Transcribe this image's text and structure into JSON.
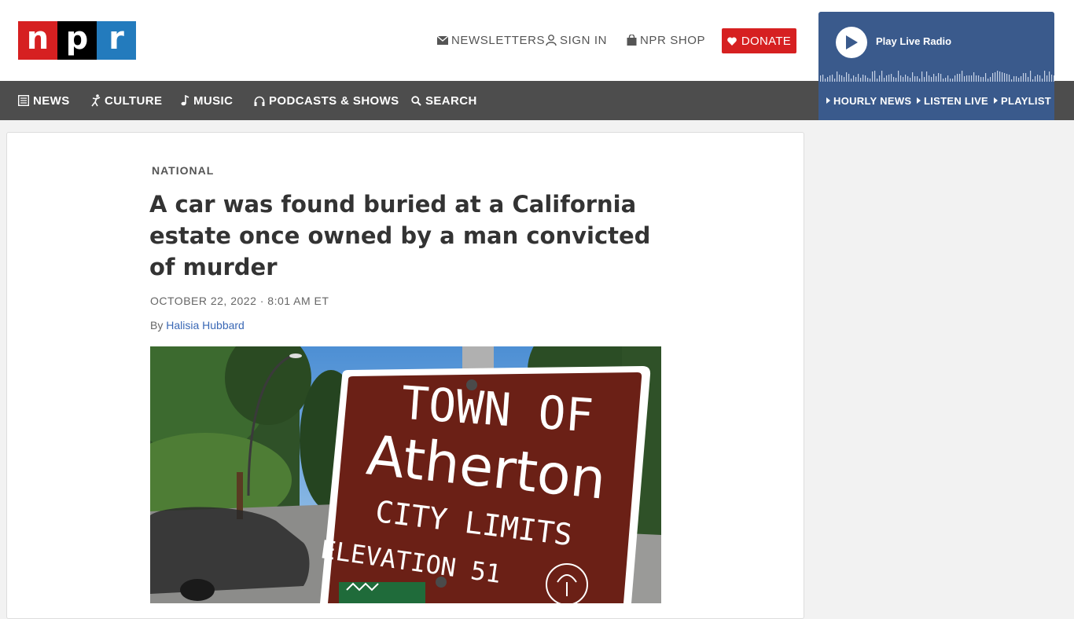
{
  "logo": {
    "letters": [
      "n",
      "p",
      "r"
    ]
  },
  "utility": {
    "newsletters": "NEWSLETTERS",
    "sign_in": "SIGN IN",
    "npr_shop": "NPR SHOP",
    "donate": "DONATE"
  },
  "nav": {
    "news": "NEWS",
    "culture": "CULTURE",
    "music": "MUSIC",
    "podcasts": "PODCASTS & SHOWS",
    "search": "SEARCH"
  },
  "radio": {
    "play_label": "Play Live Radio",
    "hourly_news": "HOURLY NEWS",
    "listen_live": "LISTEN LIVE",
    "playlist": "PLAYLIST"
  },
  "article": {
    "section": "NATIONAL",
    "headline": "A car was found buried at a California estate once owned by a man convicted of murder",
    "dateline": "OCTOBER 22, 2022 · 8:01 AM ET",
    "by": "By",
    "author": "Halisia Hubbard"
  },
  "photo": {
    "sign_line1": "TOWN OF",
    "sign_line2": "Atherton",
    "sign_line3": "CITY LIMITS",
    "sign_line4": "ELEVATION  51"
  },
  "colors": {
    "npr_red": "#d62021",
    "npr_blue": "#237bbd",
    "nav_bg": "#4d4d4d",
    "radio_bg": "#3a5a8c",
    "link": "#3a68b5"
  }
}
